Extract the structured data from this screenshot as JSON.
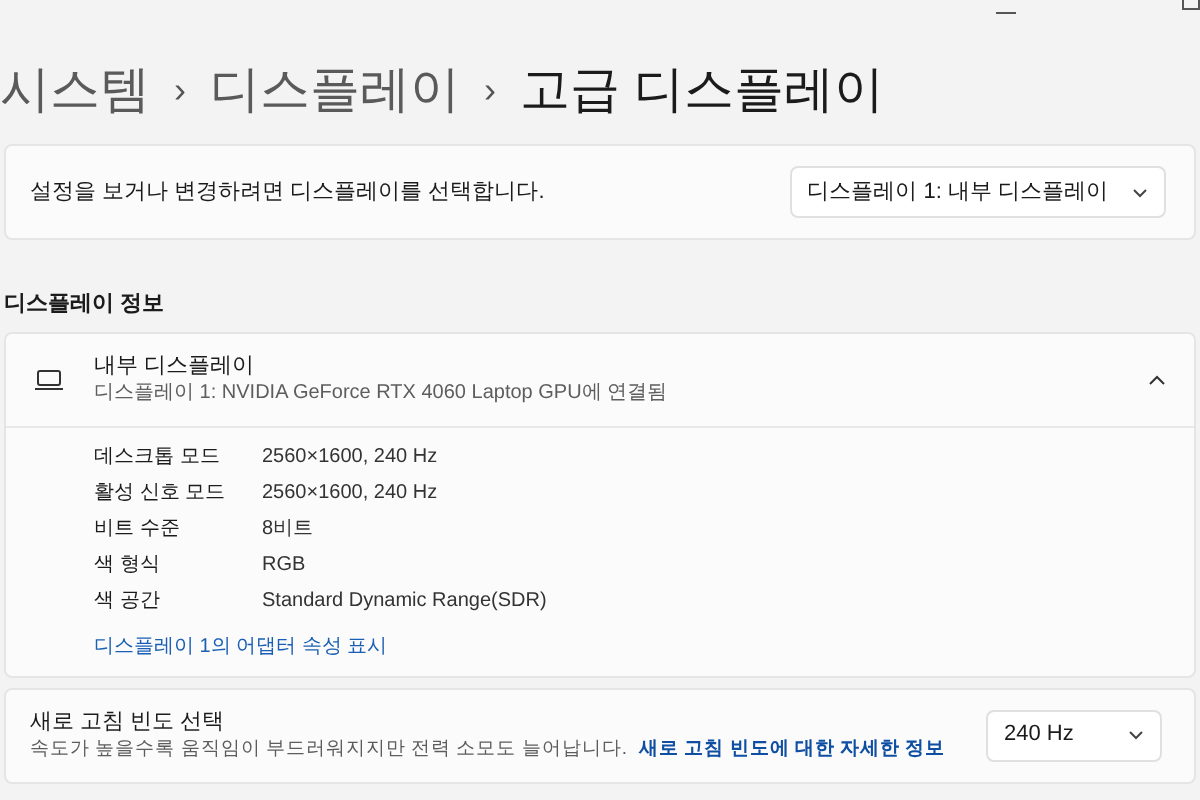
{
  "breadcrumb": [
    {
      "label": "시스템",
      "current": false
    },
    {
      "label": "디스플레이",
      "current": false
    },
    {
      "label": "고급 디스플레이",
      "current": true
    }
  ],
  "breadcrumb_separator": "›",
  "display_select": {
    "label": "설정을 보거나 변경하려면 디스플레이를 선택합니다.",
    "value": "디스플레이 1: 내부 디스플레이"
  },
  "section_title": "디스플레이 정보",
  "display_info": {
    "title": "내부 디스플레이",
    "subtitle": "디스플레이 1: NVIDIA GeForce RTX 4060 Laptop GPU에 연결됨",
    "expanded": true,
    "rows": [
      {
        "label": "데스크톱 모드",
        "value": "2560×1600, 240 Hz"
      },
      {
        "label": "활성 신호 모드",
        "value": "2560×1600, 240 Hz"
      },
      {
        "label": "비트 수준",
        "value": "8비트"
      },
      {
        "label": "색 형식",
        "value": "RGB"
      },
      {
        "label": "색 공간",
        "value": "Standard Dynamic Range(SDR)"
      }
    ],
    "link": "디스플레이 1의 어댑터 속성 표시"
  },
  "refresh_rate": {
    "title": "새로 고침 빈도 선택",
    "description": "속도가 높을수록 움직임이 부드러워지지만 전력 소모도 늘어납니다.",
    "link": "새로 고침 빈도에 대한 자세한 정보",
    "value": "240 Hz"
  }
}
